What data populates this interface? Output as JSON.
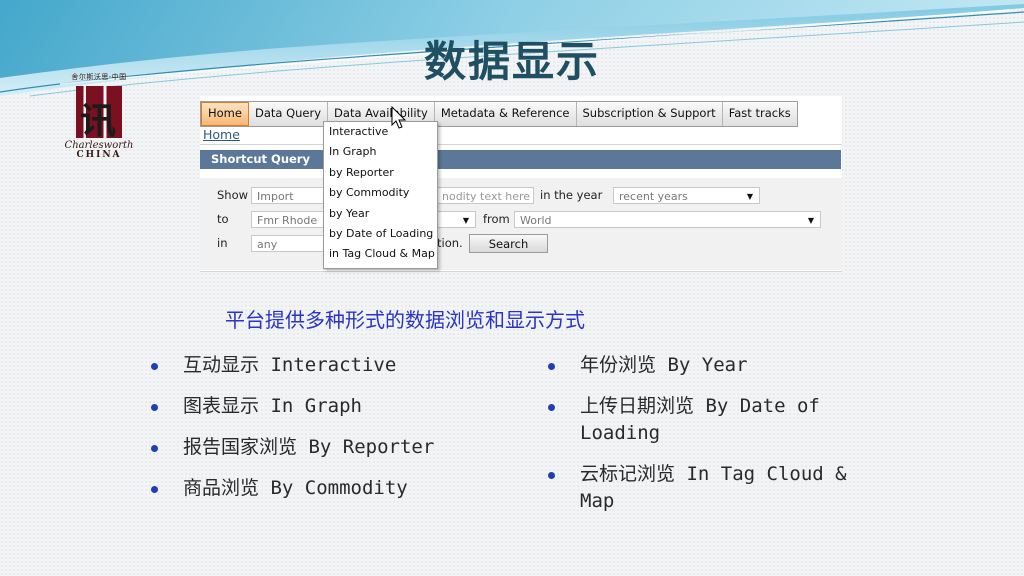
{
  "slide": {
    "title": "数据显示",
    "subtitle": "平台提供多种形式的数据浏览和显示方式"
  },
  "logo": {
    "top_text": "舍尔斯沃思·中国",
    "glyph": "讯",
    "brand": "Charlesworth",
    "brand_sub": "CHINA"
  },
  "nav": {
    "items": [
      {
        "label": "Home",
        "active": true
      },
      {
        "label": "Data Query"
      },
      {
        "label": "Data Availability"
      },
      {
        "label": "Metadata & Reference"
      },
      {
        "label": "Subscription & Support"
      },
      {
        "label": "Fast tracks"
      }
    ]
  },
  "breadcrumb": "Home",
  "shortcut_query": {
    "header": "Shortcut Query",
    "show_label": "Show",
    "show_value": "Import",
    "commodity_value": "nodity text here",
    "in_the_year_label": "in the year",
    "year_value": "recent years",
    "to_label": "to",
    "to_value": "Fmr Rhode",
    "from_label": "from",
    "from_value": "World",
    "in_label": "in",
    "in_value": "any",
    "tail_text": "tion.",
    "search_button": "Search"
  },
  "dropdown": {
    "items": [
      "Interactive",
      "In Graph",
      "by Reporter",
      "by Commodity",
      "by Year",
      "by Date of Loading",
      "in Tag Cloud & Map"
    ]
  },
  "bullets_left": [
    "互动显示 Interactive",
    "图表显示 In Graph",
    "报告国家浏览 By Reporter",
    "商品浏览  By Commodity"
  ],
  "bullets_right": [
    "年份浏览 By Year",
    "上传日期浏览 By Date of Loading",
    "云标记浏览  In Tag Cloud & Map"
  ],
  "colors": {
    "title": "#1e4f63",
    "subtitle": "#2a34c8",
    "bullet": "#1f3fb8",
    "nav_active": "#f8b874",
    "header_bar": "#5b7898"
  }
}
